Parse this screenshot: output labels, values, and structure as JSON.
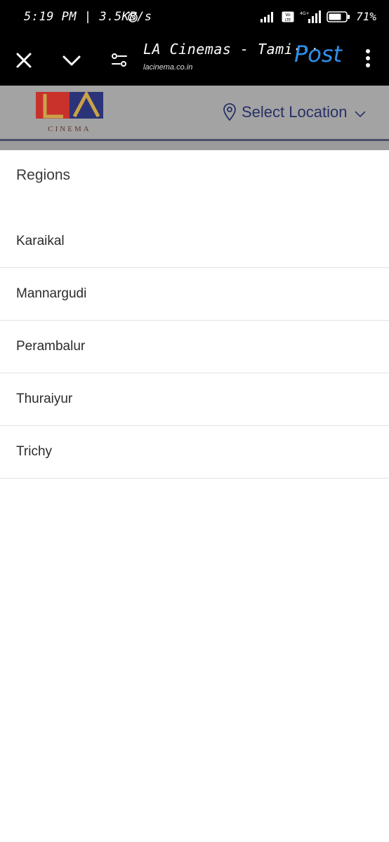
{
  "status_bar": {
    "time": "5:19 PM | 3.5KB/s",
    "net_label": "Vo LTE",
    "net2_label": "4G+",
    "battery": "71%"
  },
  "toolbar": {
    "title": "LA Cinemas - Tami···",
    "url": "lacinema.co.in",
    "post_label": "Post"
  },
  "header": {
    "logo": {
      "letters": "LA",
      "wordmark": "CINEMA",
      "colors": {
        "red": "#c8322b",
        "gold": "#c9a24a",
        "navy": "#2b3478"
      }
    },
    "location_label": "Select Location"
  },
  "regions": {
    "title": "Regions",
    "items": [
      {
        "label": "Karaikal"
      },
      {
        "label": "Mannargudi"
      },
      {
        "label": "Perambalur"
      },
      {
        "label": "Thuraiyur"
      },
      {
        "label": "Trichy"
      }
    ]
  }
}
